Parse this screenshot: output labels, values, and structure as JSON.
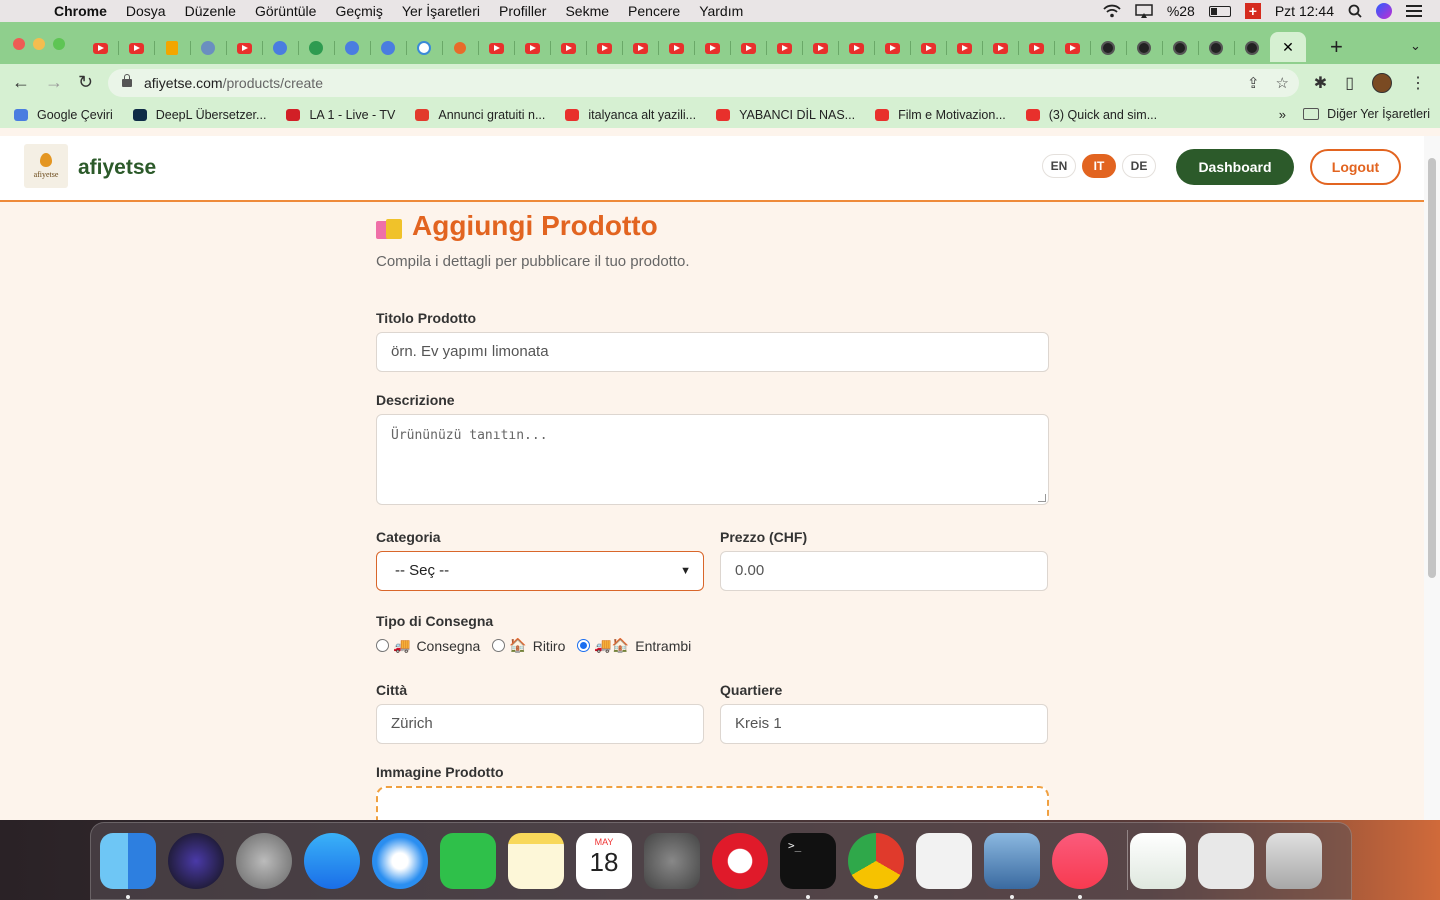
{
  "menubar": {
    "app": "Chrome",
    "items": [
      "Dosya",
      "Düzenle",
      "Görüntüle",
      "Geçmiş",
      "Yer İşaretleri",
      "Profiller",
      "Sekme",
      "Pencere",
      "Yardım"
    ],
    "battery": "%28",
    "clock": "Pzt 12:44"
  },
  "browser": {
    "url_host": "afiyetse.com",
    "url_path": "/products/create",
    "favicon_tabs": [
      "youtube",
      "youtube",
      "analytics",
      "gray",
      "youtube",
      "translate",
      "green",
      "spark",
      "blue",
      "web",
      "orange",
      "youtube",
      "youtube",
      "youtube",
      "youtube",
      "youtube",
      "youtube",
      "youtube",
      "youtube",
      "youtube",
      "youtube",
      "youtube",
      "youtube",
      "youtube",
      "youtube",
      "youtube",
      "youtube",
      "youtube",
      "globe",
      "globe",
      "globe",
      "globe",
      "globe"
    ],
    "active_tab_close": "✕"
  },
  "bookmarks": {
    "items": [
      {
        "label": "Google Çeviri",
        "color": "#4a7de0"
      },
      {
        "label": "DeepL Übersetzer...",
        "color": "#0f2b46"
      },
      {
        "label": "LA 1 - Live - TV",
        "color": "#d21f26"
      },
      {
        "label": "Annunci gratuiti n...",
        "color": "#e23a2c"
      },
      {
        "label": "italyanca alt yazili...",
        "color": "#e8302c"
      },
      {
        "label": "YABANCI DİL NAS...",
        "color": "#e8302c"
      },
      {
        "label": "Film e Motivazion...",
        "color": "#e8302c"
      },
      {
        "label": "(3) Quick and sim...",
        "color": "#e8302c"
      }
    ],
    "more": "»",
    "other": "Diğer Yer İşaretleri"
  },
  "site": {
    "logo_text": "afiyetse",
    "brand": "afiyetse",
    "languages": [
      "EN",
      "IT",
      "DE"
    ],
    "active_language": "IT",
    "dashboard_label": "Dashboard",
    "logout_label": "Logout"
  },
  "form": {
    "title": "Aggiungi Prodotto",
    "subtitle": "Compila i dettagli per pubblicare il tuo prodotto.",
    "title_label": "Titolo Prodotto",
    "title_placeholder": "örn. Ev yapımı limonata",
    "description_label": "Descrizione",
    "description_placeholder": "Ürününüzü tanıtın...",
    "category_label": "Categoria",
    "category_value": "-- Seç --",
    "price_label": "Prezzo (CHF)",
    "price_placeholder": "0.00",
    "delivery_label": "Tipo di Consegna",
    "delivery_options": [
      {
        "emoji": "🚚",
        "label": "Consegna",
        "checked": false
      },
      {
        "emoji": "🏠",
        "label": "Ritiro",
        "checked": false
      },
      {
        "emoji": "🚚🏠",
        "label": "Entrambi",
        "checked": true
      }
    ],
    "city_label": "Città",
    "city_placeholder": "Zürich",
    "district_label": "Quartiere",
    "district_placeholder": "Kreis 1",
    "image_label": "Immagine Prodotto"
  },
  "dock": {
    "calendar_month": "MAY",
    "calendar_day": "18",
    "apps": [
      "finder",
      "siri",
      "launchpad",
      "app-store",
      "safari",
      "facetime",
      "notes",
      "calendar",
      "system-preferences",
      "opera",
      "terminal",
      "chrome",
      "textedit",
      "preview",
      "music",
      "window-1",
      "window-2",
      "trash"
    ]
  }
}
